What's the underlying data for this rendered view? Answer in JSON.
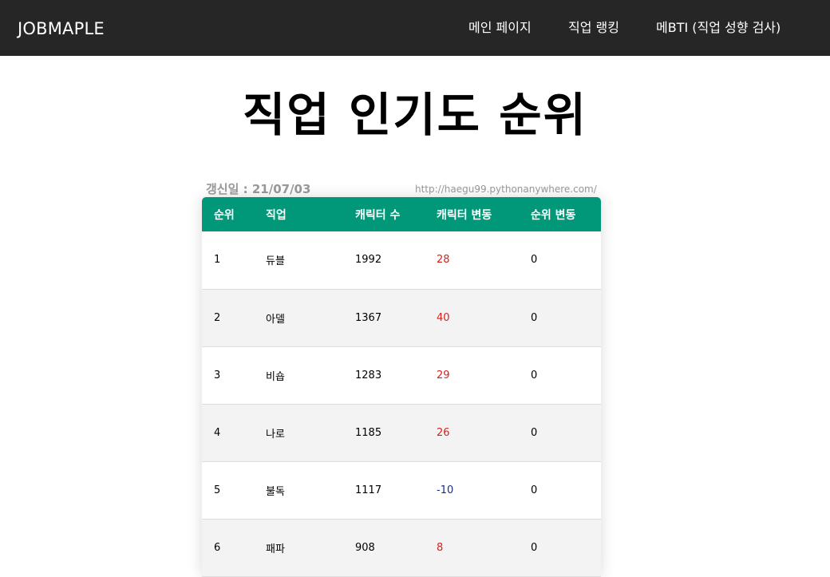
{
  "navbar": {
    "brand": "JOBMAPLE",
    "links": [
      "메인 페이지",
      "직업 랭킹",
      "메BTI (직업 성향 검사)"
    ]
  },
  "page": {
    "title": "직업 인기도 순위",
    "updated": "갱신일 : 21/07/03",
    "url": "http://haegu99.pythonanywhere.com/"
  },
  "table": {
    "headers": [
      "순위",
      "직업",
      "캐릭터 수",
      "캐릭터 변동",
      "순위 변동"
    ],
    "rows": [
      [
        "1",
        "듀블",
        "1992",
        "28",
        "0"
      ],
      [
        "2",
        "아델",
        "1367",
        "40",
        "0"
      ],
      [
        "3",
        "비숍",
        "1283",
        "29",
        "0"
      ],
      [
        "4",
        "나로",
        "1185",
        "26",
        "0"
      ],
      [
        "5",
        "불독",
        "1117",
        "-10",
        "0"
      ],
      [
        "6",
        "패파",
        "908",
        "8",
        "0"
      ]
    ]
  },
  "colors": {
    "navbar": "#262626",
    "table_header": "#009879",
    "increase": "#d9211b",
    "decrease": "#1a2c8c"
  }
}
